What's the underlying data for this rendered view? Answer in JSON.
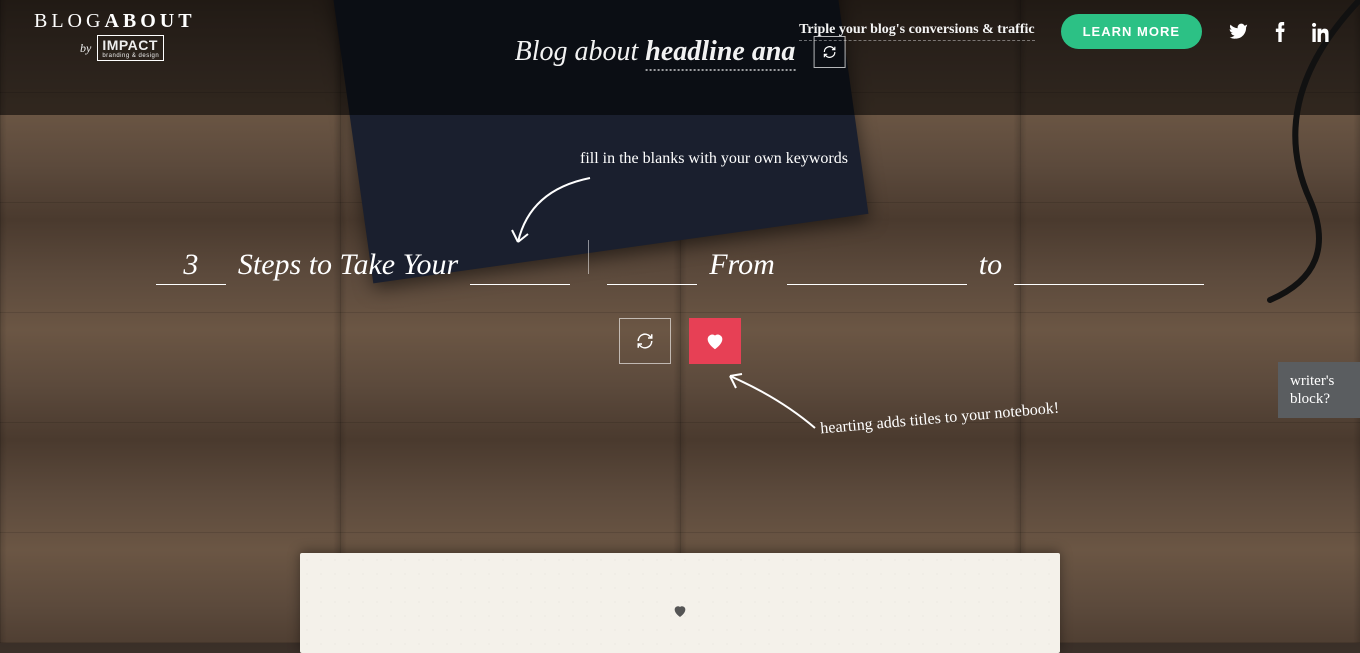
{
  "logo": {
    "part1": "BLOG",
    "part2": "ABOUT",
    "by": "by",
    "impact": "IMPACT",
    "impact_sub": "branding & design"
  },
  "header": {
    "promo": "Triple your blog's conversions & traffic",
    "cta": "LEARN MORE"
  },
  "blog_about": {
    "prefix": "Blog about ",
    "topic": "headline ana"
  },
  "hints": {
    "fill": "fill in the blanks with your own keywords",
    "heart": "hearting adds titles to your notebook!"
  },
  "headline": {
    "blank1_value": "3",
    "text1": "Steps to Take Your",
    "text2": "From",
    "text3": "to"
  },
  "sidebar": {
    "writers_block": "writer's block?"
  },
  "colors": {
    "cta": "#2cc185",
    "heart_btn": "#e74055"
  }
}
